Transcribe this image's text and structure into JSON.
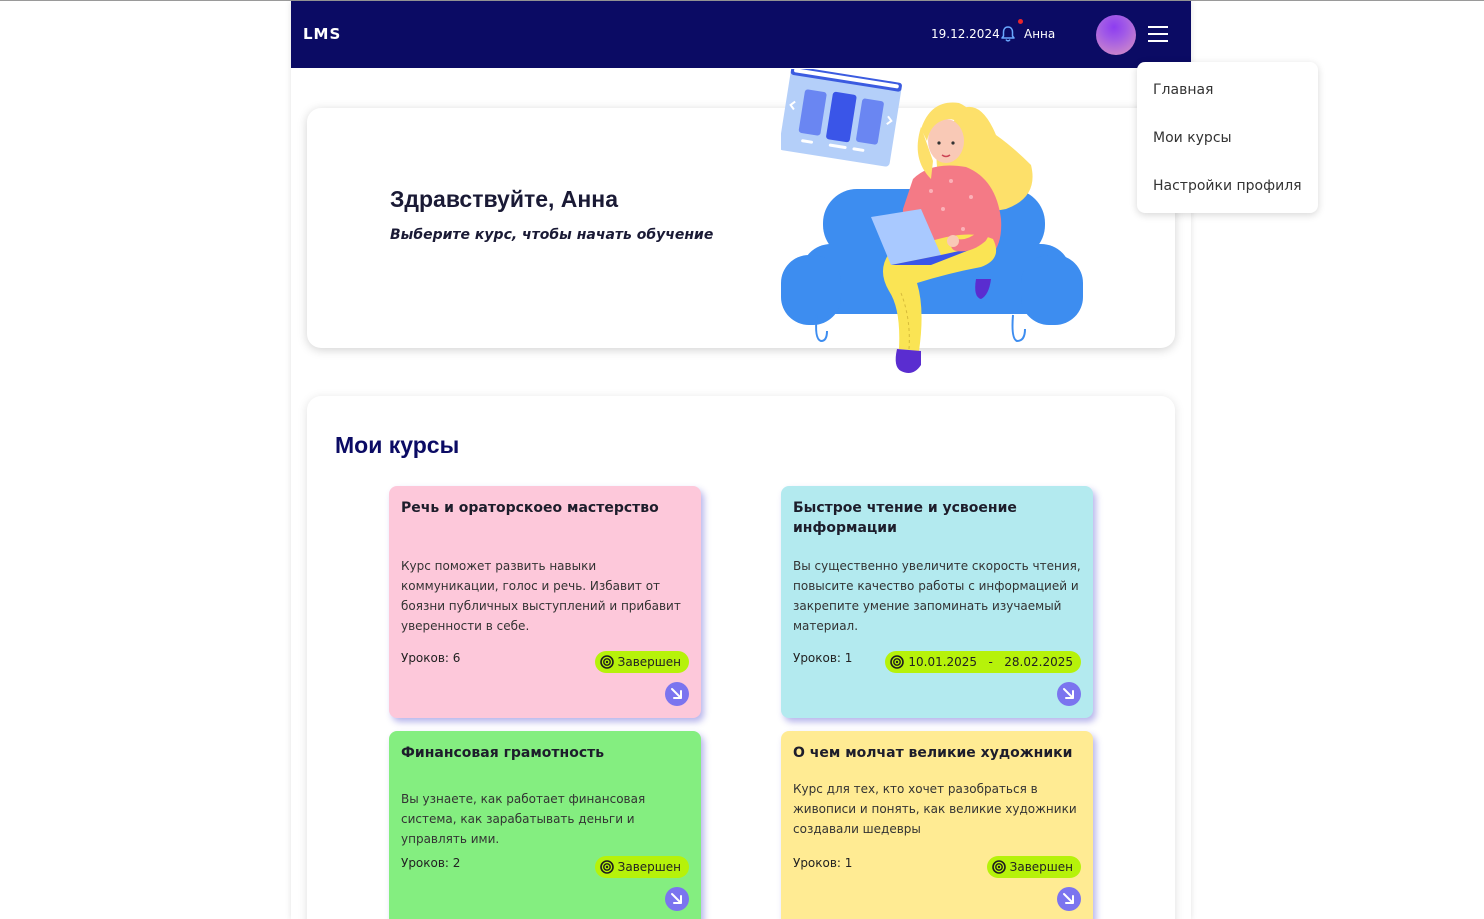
{
  "header": {
    "logo": "LMS",
    "date": "19.12.2024",
    "user_name": "Анна"
  },
  "menu": {
    "items": [
      {
        "label": "Главная"
      },
      {
        "label": "Мои курсы"
      },
      {
        "label": "Настройки профиля"
      }
    ]
  },
  "hero": {
    "title": "Здравствуйте, Анна",
    "subtitle": "Выберите курс, чтобы начать обучение"
  },
  "courses": {
    "section_title": "Мои курсы",
    "items": [
      {
        "title": "Речь и ораторскоео мастерство",
        "description": "Курс поможет развить навыки коммуникации, голос и речь. Избавит от боязни публичных выступлений и прибавит уверенности в себе.",
        "lessons": "Уроков: 6",
        "status": "Завершен",
        "color": "#fdc8da"
      },
      {
        "title": "Быстрое чтение и усвоение информации",
        "description": "Вы существенно увеличите скорость чтения, повысите качество работы с информацией и закрепите умение запоминать изучаемый материал.",
        "lessons": "Уроков: 1",
        "status": "10.01.2025   -   28.02.2025",
        "color": "#b3eaef"
      },
      {
        "title": "Финансовая грамотность",
        "description": "Вы узнаете, как работает финансовая система, как зарабатывать деньги и управлять ими.",
        "lessons": "Уроков: 2",
        "status": "Завершен",
        "color": "#84ee80"
      },
      {
        "title": "О чем молчат великие художники",
        "description": "Курс для тех, кто хочет разобраться в живописи и понять, как великие художники создавали шедевры",
        "lessons": "Уроков: 1",
        "status": "Завершен",
        "color": "#ffeb93"
      }
    ]
  },
  "colors": {
    "header_bg": "#0b0b64",
    "accent": "#7b74ef",
    "badge": "#b6f20a"
  }
}
